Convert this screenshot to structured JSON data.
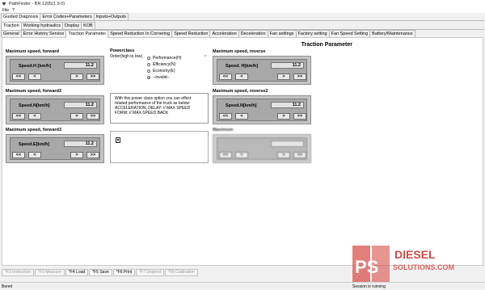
{
  "window": {
    "title": "PathFinder - BR 1205(1.9.0)"
  },
  "menu": {
    "items": [
      "File",
      "?"
    ]
  },
  "main_tabs": [
    "Guided Diagnosis",
    "Error Codes+Parameters",
    "Inputs+Outputs"
  ],
  "sub_tabs": [
    "Traction",
    "Working hydraulics",
    "Display",
    "KOB"
  ],
  "param_tabs": [
    "General",
    "Error History Service",
    "Traction Parameter",
    "Speed Reduction In Cornering",
    "Speed Reduction",
    "Acceleration",
    "Deceleration",
    "Fan settings",
    "Factory setting",
    "Fan Speed Setting",
    "Battery/Maintenance"
  ],
  "section_title": "Traction Parameter",
  "nav_buttons": {
    "first": "<<",
    "prev": "<",
    "next": ">",
    "last": ">>"
  },
  "speeds": {
    "fwd": {
      "title": "Maximum speed, forward",
      "label": "Speed.H [km/h]",
      "value": "11.2"
    },
    "fwd2": {
      "title": "Maximum speed, forward2",
      "label": "Speed.N[km/h]",
      "value": "11.2"
    },
    "fwd3": {
      "title": "Maximum speed, forward3",
      "label": "Speed.E[km/h]",
      "value": "11.2"
    },
    "rev": {
      "title": "Maximum speed, reverse",
      "label": "Speed. H[km/h]",
      "value": "11.2"
    },
    "rev2": {
      "title": "Maximum speed, reverse2",
      "label": "Speed.N[km/h]",
      "value": "11.2"
    },
    "rev3": {
      "title": "Maximum",
      "label": "",
      "value": ""
    }
  },
  "powerclass": {
    "title": "Powerclass",
    "subtitle": "Order(high to low)",
    "star": "*",
    "options": [
      "Performance(H)",
      "Efficiency(N)",
      "Economy(E)",
      "--invalid--"
    ],
    "selected": "--invalid--"
  },
  "info_text": "With this power class option you can effect related performance of the truck as below: ACCELERATION, DELAY: // MAX SPEED FORW; // MAX SPEED BACK",
  "fkeys": [
    "*F2 Instruction",
    "*F3 Measure",
    "*F4 Load",
    "*F5 Save",
    "*F6 Print",
    "*F7 Depend",
    "*F8 Calibration"
  ],
  "fkeys_enabled": [
    false,
    false,
    true,
    true,
    true,
    false,
    false
  ],
  "status": {
    "left": "Bereit",
    "right": "Session is running"
  },
  "watermark": {
    "text1": "PS",
    "text2": "DIESEL",
    "text3": "SOLUTIONS.COM"
  }
}
